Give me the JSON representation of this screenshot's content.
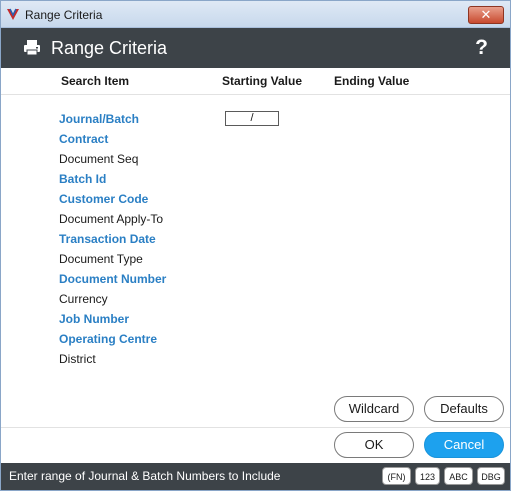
{
  "window": {
    "title": "Range Criteria",
    "close_glyph": "✕"
  },
  "header": {
    "title": "Range Criteria",
    "help_glyph": "?"
  },
  "columns": {
    "search_item": "Search Item",
    "starting_value": "Starting Value",
    "ending_value": "Ending Value"
  },
  "items": [
    {
      "label": "Journal/Batch",
      "style": "link"
    },
    {
      "label": "Contract",
      "style": "link"
    },
    {
      "label": "Document Seq",
      "style": "plain"
    },
    {
      "label": "Batch Id",
      "style": "link"
    },
    {
      "label": "Customer Code",
      "style": "link"
    },
    {
      "label": "Document Apply-To",
      "style": "plain"
    },
    {
      "label": "Transaction Date",
      "style": "link"
    },
    {
      "label": "Document Type",
      "style": "plain"
    },
    {
      "label": "Document Number",
      "style": "link"
    },
    {
      "label": "Currency",
      "style": "plain"
    },
    {
      "label": "Job Number",
      "style": "link"
    },
    {
      "label": "Operating Centre",
      "style": "link"
    },
    {
      "label": "District",
      "style": "plain"
    }
  ],
  "journal_batch_input": {
    "value": "/"
  },
  "buttons": {
    "wildcard": "Wildcard",
    "defaults": "Defaults",
    "ok": "OK",
    "cancel": "Cancel"
  },
  "status": {
    "message": "Enter range of Journal & Batch Numbers to Include",
    "badges": [
      "(FN)",
      "123",
      "ABC",
      "DBG"
    ]
  },
  "colors": {
    "link": "#2a7fc4",
    "header_bg": "#3d4348",
    "primary_button": "#1da1ee"
  }
}
